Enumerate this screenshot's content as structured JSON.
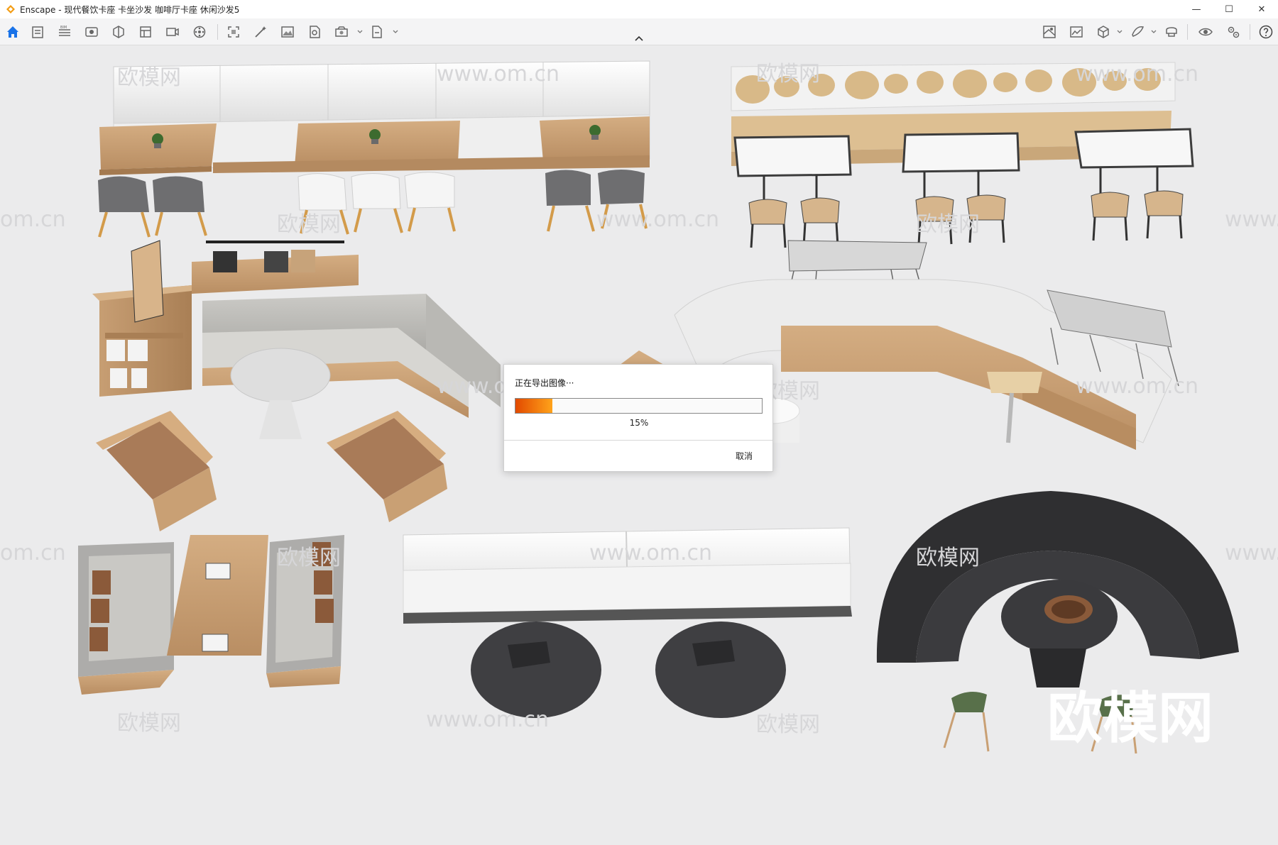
{
  "window": {
    "title": "Enscape - 现代餐饮卡座 卡坐沙发 咖啡厅卡座  休闲沙发5",
    "minimize_glyph": "—",
    "maximize_glyph": "☐",
    "close_glyph": "✕"
  },
  "toolbar": {
    "left_icons": [
      "home-icon",
      "assets-icon",
      "bim-icon",
      "view-icon",
      "visual-settings-icon",
      "views-icon",
      "video-icon",
      "panorama-icon",
      "screenshot-icon",
      "magic-icon",
      "render-image-icon",
      "export-icon",
      "batch-render-icon",
      "file-export-icon"
    ],
    "right_icons": [
      "map-icon",
      "image-settings-icon",
      "cube-icon",
      "paint-icon",
      "vr-icon",
      "eye-icon",
      "settings-icon",
      "help-icon"
    ],
    "accent": "#1a73e8"
  },
  "watermarks": {
    "brand_cn": "欧模网",
    "site": "www.om.cn",
    "site_short": "om.cn"
  },
  "dialog": {
    "message": "正在导出图像···",
    "progress_percent": 15,
    "progress_label": "15%",
    "cancel_label": "取消",
    "progress_color_start": "#e24a00",
    "progress_color_end": "#ffa31a"
  }
}
